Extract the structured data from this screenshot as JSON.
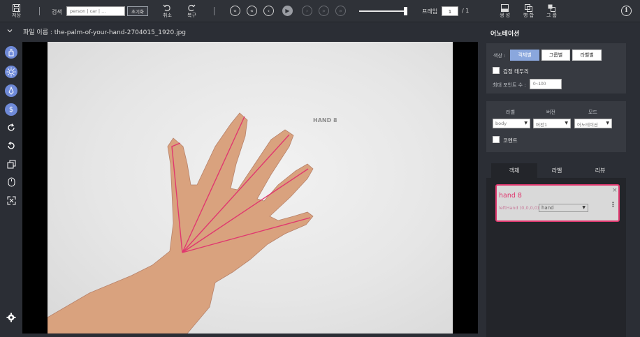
{
  "toolbar": {
    "save_label": "저장",
    "search_label": "검색",
    "search_placeholder": "person | car | ...",
    "reset_label": "초기화",
    "undo_label": "취소",
    "redo_label": "복구",
    "nav": {
      "first": "«",
      "prev_fast": "«",
      "prev": "‹",
      "play": "▶",
      "next": "›",
      "next_fast": "»",
      "last": "»"
    },
    "playback_progress": 1.0,
    "frame_label": "프레임",
    "frame_value": "1",
    "frame_total": "/ 1",
    "create_label": "생 성",
    "merge_label": "병 합",
    "group_label": "그 룹",
    "info_glyph": "i"
  },
  "file": {
    "name_label": "파일 이름 : the-palm-of-your-hand-2704015_1920.jpg"
  },
  "canvas": {
    "object_tag": "HAND 8"
  },
  "annotation_panel": {
    "title": "어노테이션",
    "color_label": "색상 :",
    "color_modes": [
      "객체별",
      "그룹별",
      "라벨별"
    ],
    "active_color_mode": "객체별",
    "black_border_label": "검정 테두리",
    "max_points_label": "최대 포인트 수 :",
    "max_points_placeholder": "0~100",
    "filter_labels": {
      "label": "라벨",
      "version": "버전",
      "mode": "모드"
    },
    "filter_values": {
      "label": "body",
      "version": "버전1",
      "mode": "어노테이션"
    },
    "comment_label": "코멘트",
    "tabs": [
      "객체",
      "라벨",
      "리뷰"
    ],
    "active_tab": "객체"
  },
  "object_card": {
    "title": "hand 8",
    "close_glyph": "×",
    "subtitle": "leftHand (0,0,0,0)",
    "label_value": "hand",
    "kebab_glyph": "⋮"
  },
  "colors": {
    "accent": "#8aa7dd",
    "annotation": "#e0386f",
    "tool_blue": "#6f8ad8",
    "background": "#2b2e35"
  },
  "icons": {
    "left_tools": [
      "hand-drag-icon",
      "brightness-icon",
      "pen-nib-icon",
      "dollar-tool-icon",
      "rotate-cw-icon",
      "rotate-ccw-icon",
      "copy-icon",
      "mouse-icon",
      "fullscreen-icon",
      "settings-icon"
    ]
  }
}
